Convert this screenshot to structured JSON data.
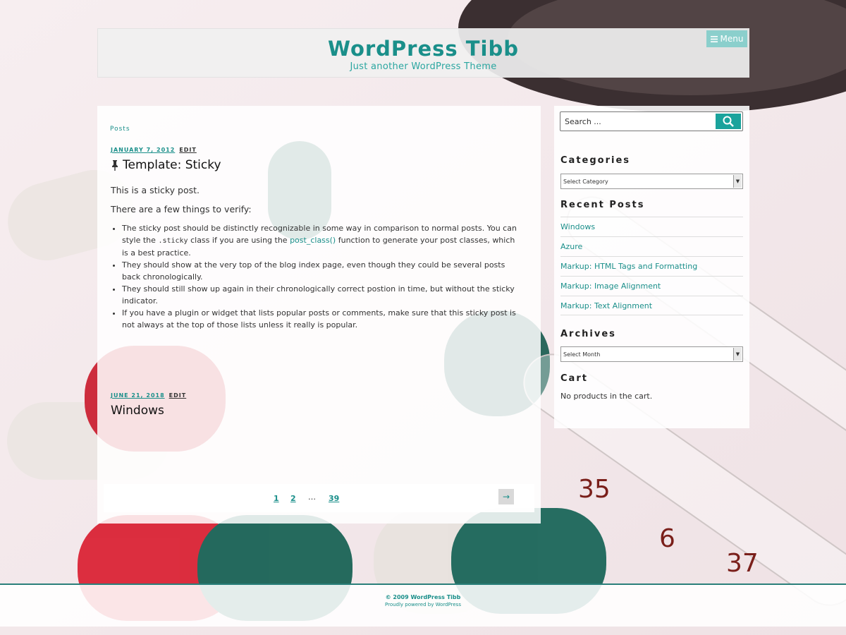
{
  "header": {
    "site_title": "WordPress Tibb",
    "site_description": "Just another WordPress Theme",
    "menu_label": "Menu"
  },
  "breadcrumb": "Posts",
  "posts": [
    {
      "date": "JANUARY 7, 2012",
      "edit": "EDIT",
      "title": "Template: Sticky",
      "paragraphs": [
        "This is a sticky post.",
        "There are a few things to verify:"
      ],
      "bullets": [
        {
          "pre": "The sticky post should be distinctly recognizable in some way in comparison to normal posts. You can style the ",
          "code": ".sticky",
          "mid": " class if you are using the ",
          "link": "post_class()",
          "post": " function to generate your post classes, which is a best practice."
        },
        "They should show at the very top of the blog index page, even though they could be several posts back chronologically.",
        "They should still show up again in their chronologically correct postion in time, but without the sticky indicator.",
        "If you have a plugin or widget that lists popular posts or comments, make sure that this sticky post is not always at the top of those lists unless it really is popular."
      ]
    },
    {
      "date": "JUNE 21, 2018",
      "edit": "EDIT",
      "title": "Windows"
    }
  ],
  "pagination": {
    "pages": [
      "1",
      "2",
      "39"
    ],
    "dots": "…",
    "next": "→"
  },
  "sidebar": {
    "search_placeholder": "Search ...",
    "categories_title": "Categories",
    "categories_select": "Select Category",
    "recent_title": "Recent Posts",
    "recent_posts": [
      "Windows",
      "Azure",
      "Markup: HTML Tags and Formatting",
      "Markup: Image Alignment",
      "Markup: Text Alignment"
    ],
    "archives_title": "Archives",
    "archives_select": "Select Month",
    "cart_title": "Cart",
    "cart_text": "No products in the cart."
  },
  "footer": {
    "copyright": "© 2009 WordPress Tibb",
    "powered_by": "Proudly powered by WordPress"
  },
  "colors": {
    "accent": "#1a8f8a",
    "accent_light": "#8bcfcc",
    "search_button": "#1aa39c"
  }
}
